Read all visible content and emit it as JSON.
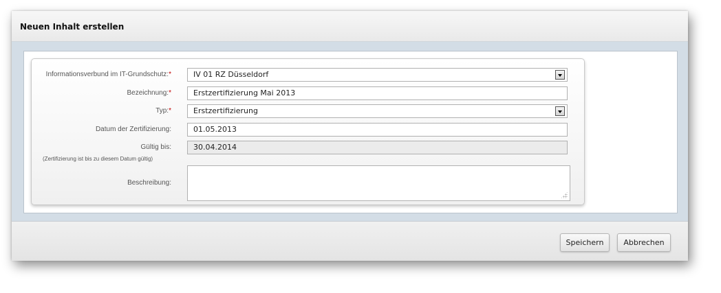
{
  "dialog": {
    "title": "Neuen Inhalt erstellen"
  },
  "form": {
    "required_marker": "*",
    "informationsverbund": {
      "label": "Informationsverbund im IT-Grundschutz:",
      "value": "IV 01 RZ Düsseldorf"
    },
    "bezeichnung": {
      "label": "Bezeichnung:",
      "value": "Erstzertifizierung Mai 2013"
    },
    "typ": {
      "label": "Typ:",
      "value": "Erstzertifizierung"
    },
    "datum": {
      "label": "Datum der Zertifizierung:",
      "value": "01.05.2013"
    },
    "gueltig": {
      "label": "Gültig bis:",
      "hint": "(Zertifizierung ist bis zu diesem Datum gültig)",
      "value": "30.04.2014"
    },
    "beschreibung": {
      "label": "Beschreibung:",
      "value": ""
    }
  },
  "footer": {
    "save_label": "Speichern",
    "cancel_label": "Abbrechen"
  },
  "icons": {
    "dropdown": "chevron-down-icon",
    "resize": "resize-grip-icon"
  }
}
